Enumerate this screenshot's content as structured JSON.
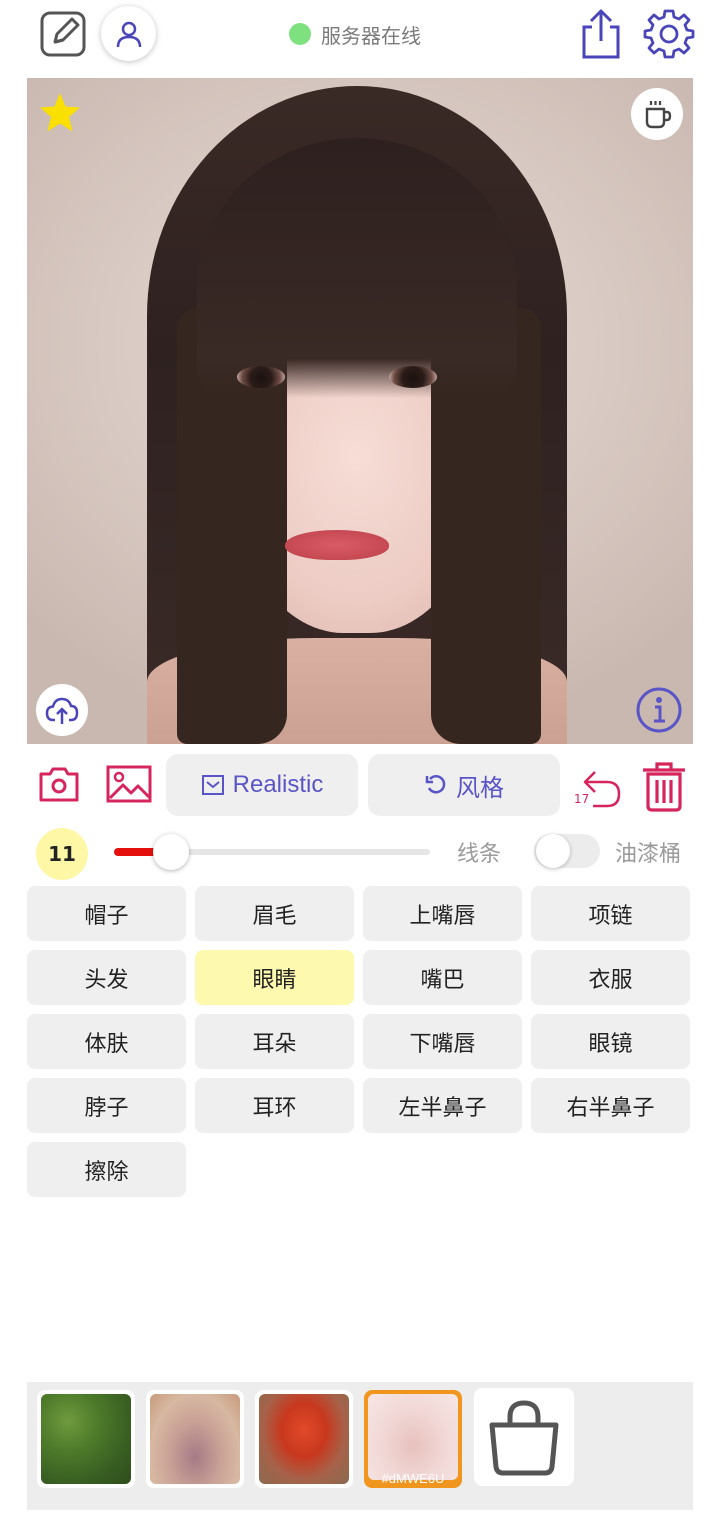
{
  "header": {
    "status_text": "服务器在线",
    "status_color": "#7fe07f"
  },
  "toolbar": {
    "realistic_label": "Realistic",
    "style_label": "风格",
    "undo_count": "17",
    "accent_color": "#5a55c7",
    "danger_color": "#d6245c"
  },
  "brush": {
    "size": "11",
    "line_label": "线条",
    "bucket_label": "油漆桶",
    "slider_value_fraction": 0.18,
    "bucket_enabled": false
  },
  "parts": [
    {
      "label": "帽子",
      "active": false
    },
    {
      "label": "眉毛",
      "active": false
    },
    {
      "label": "上嘴唇",
      "active": false
    },
    {
      "label": "项链",
      "active": false
    },
    {
      "label": "头发",
      "active": false
    },
    {
      "label": "眼睛",
      "active": true
    },
    {
      "label": "嘴巴",
      "active": false
    },
    {
      "label": "衣服",
      "active": false
    },
    {
      "label": "体肤",
      "active": false
    },
    {
      "label": "耳朵",
      "active": false
    },
    {
      "label": "下嘴唇",
      "active": false
    },
    {
      "label": "眼镜",
      "active": false
    },
    {
      "label": "脖子",
      "active": false
    },
    {
      "label": "耳环",
      "active": false
    },
    {
      "label": "左半鼻子",
      "active": false
    },
    {
      "label": "右半鼻子",
      "active": false
    },
    {
      "label": "擦除",
      "active": false
    }
  ],
  "gallery": {
    "selected_tag": "#dMWE6U"
  },
  "icons": {
    "edit": "edit-square-icon",
    "user": "user-icon",
    "share": "share-icon",
    "settings": "gear-icon",
    "favorite": "star-icon",
    "coffee": "coffee-cup-icon",
    "upload": "cloud-upload-icon",
    "info": "info-icon",
    "camera": "camera-icon",
    "gallery": "image-icon",
    "undo": "undo-icon",
    "trash": "trash-icon",
    "shop": "shopping-bag-icon"
  }
}
